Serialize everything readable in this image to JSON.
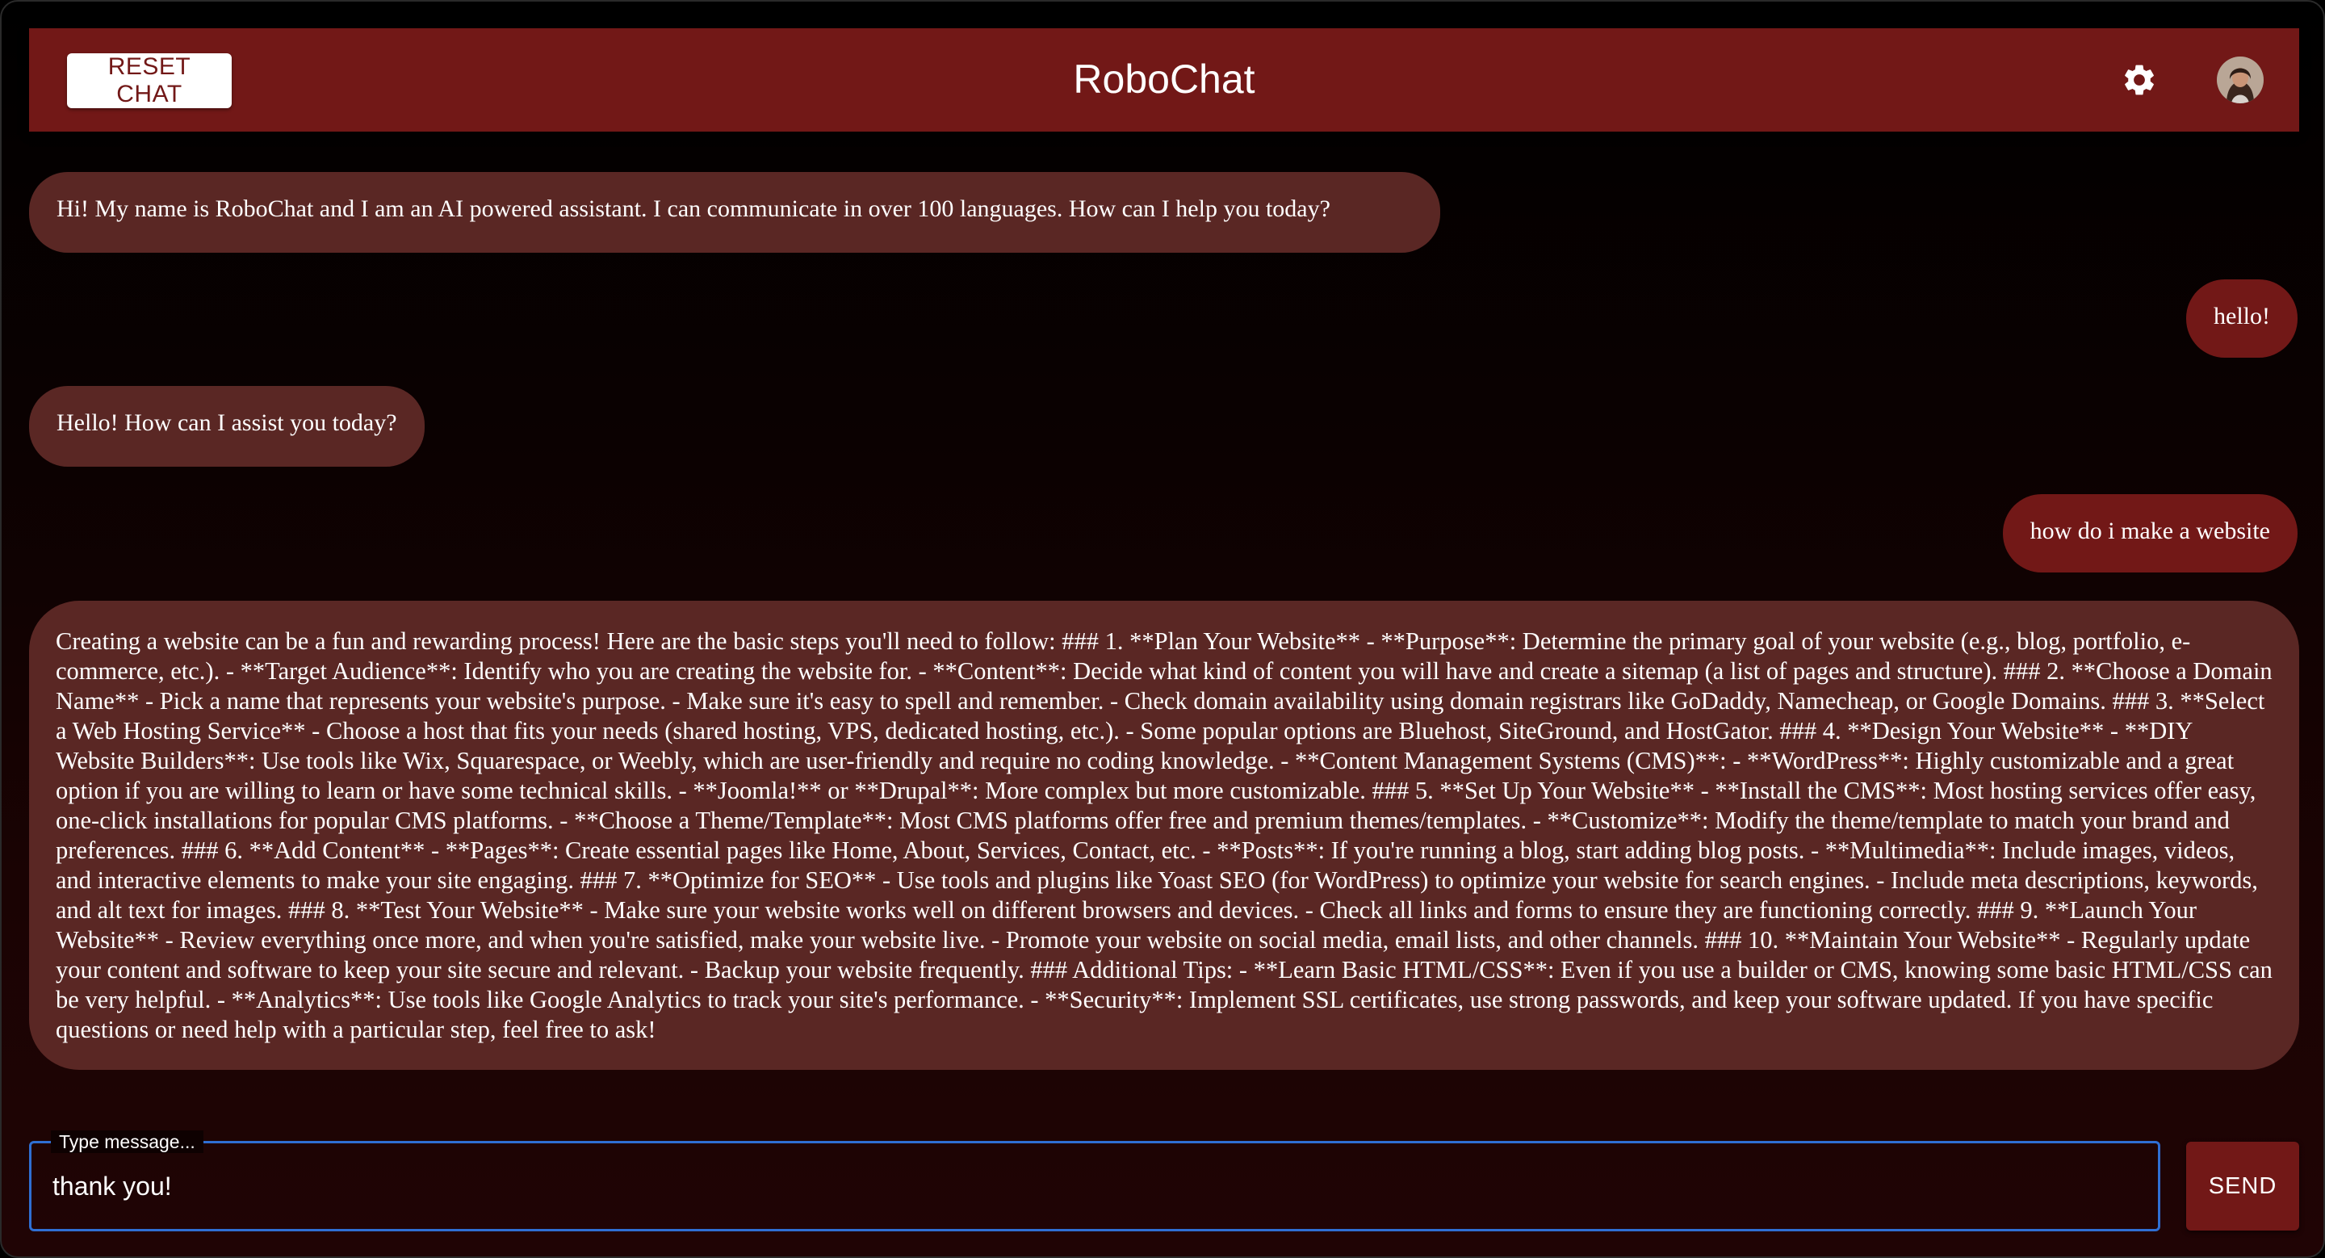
{
  "header": {
    "reset_label": "RESET CHAT",
    "title": "RoboChat",
    "settings_icon": "gear-icon",
    "avatar_icon": "user-avatar"
  },
  "colors": {
    "brand": "#721817",
    "bot_bubble": "#5a2724",
    "user_bubble": "#721817",
    "input_focus": "#2f6fd3"
  },
  "messages": [
    {
      "role": "bot",
      "text": "Hi! My name is RoboChat and I am an AI powered assistant. I can communicate in over 100 languages. How can I help you today?"
    },
    {
      "role": "user",
      "text": "hello!"
    },
    {
      "role": "bot",
      "text": "Hello! How can I assist you today?"
    },
    {
      "role": "user",
      "text": "how do i make a website"
    },
    {
      "role": "bot",
      "text": "Creating a website can be a fun and rewarding process! Here are the basic steps you'll need to follow: ### 1. **Plan Your Website** - **Purpose**: Determine the primary goal of your website (e.g., blog, portfolio, e-commerce, etc.). - **Target Audience**: Identify who you are creating the website for. - **Content**: Decide what kind of content you will have and create a sitemap (a list of pages and structure). ### 2. **Choose a Domain Name** - Pick a name that represents your website's purpose. - Make sure it's easy to spell and remember. - Check domain availability using domain registrars like GoDaddy, Namecheap, or Google Domains. ### 3. **Select a Web Hosting Service** - Choose a host that fits your needs (shared hosting, VPS, dedicated hosting, etc.). - Some popular options are Bluehost, SiteGround, and HostGator. ### 4. **Design Your Website** - **DIY Website Builders**: Use tools like Wix, Squarespace, or Weebly, which are user-friendly and require no coding knowledge. - **Content Management Systems (CMS)**: - **WordPress**: Highly customizable and a great option if you are willing to learn or have some technical skills. - **Joomla!** or **Drupal**: More complex but more customizable. ### 5. **Set Up Your Website** - **Install the CMS**: Most hosting services offer easy, one-click installations for popular CMS platforms. - **Choose a Theme/Template**: Most CMS platforms offer free and premium themes/templates. - **Customize**: Modify the theme/template to match your brand and preferences. ### 6. **Add Content** - **Pages**: Create essential pages like Home, About, Services, Contact, etc. - **Posts**: If you're running a blog, start adding blog posts. - **Multimedia**: Include images, videos, and interactive elements to make your site engaging. ### 7. **Optimize for SEO** - Use tools and plugins like Yoast SEO (for WordPress) to optimize your website for search engines. - Include meta descriptions, keywords, and alt text for images. ### 8. **Test Your Website** - Make sure your website works well on different browsers and devices. - Check all links and forms to ensure they are functioning correctly. ### 9. **Launch Your Website** - Review everything once more, and when you're satisfied, make your website live. - Promote your website on social media, email lists, and other channels. ### 10. **Maintain Your Website** - Regularly update your content and software to keep your site secure and relevant. - Backup your website frequently. ### Additional Tips: - **Learn Basic HTML/CSS**: Even if you use a builder or CMS, knowing some basic HTML/CSS can be very helpful. - **Analytics**: Use tools like Google Analytics to track your site's performance. - **Security**: Implement SSL certificates, use strong passwords, and keep your software updated. If you have specific questions or need help with a particular step, feel free to ask!"
    }
  ],
  "composer": {
    "label": "Type message...",
    "value": "thank you!",
    "send_label": "SEND"
  }
}
